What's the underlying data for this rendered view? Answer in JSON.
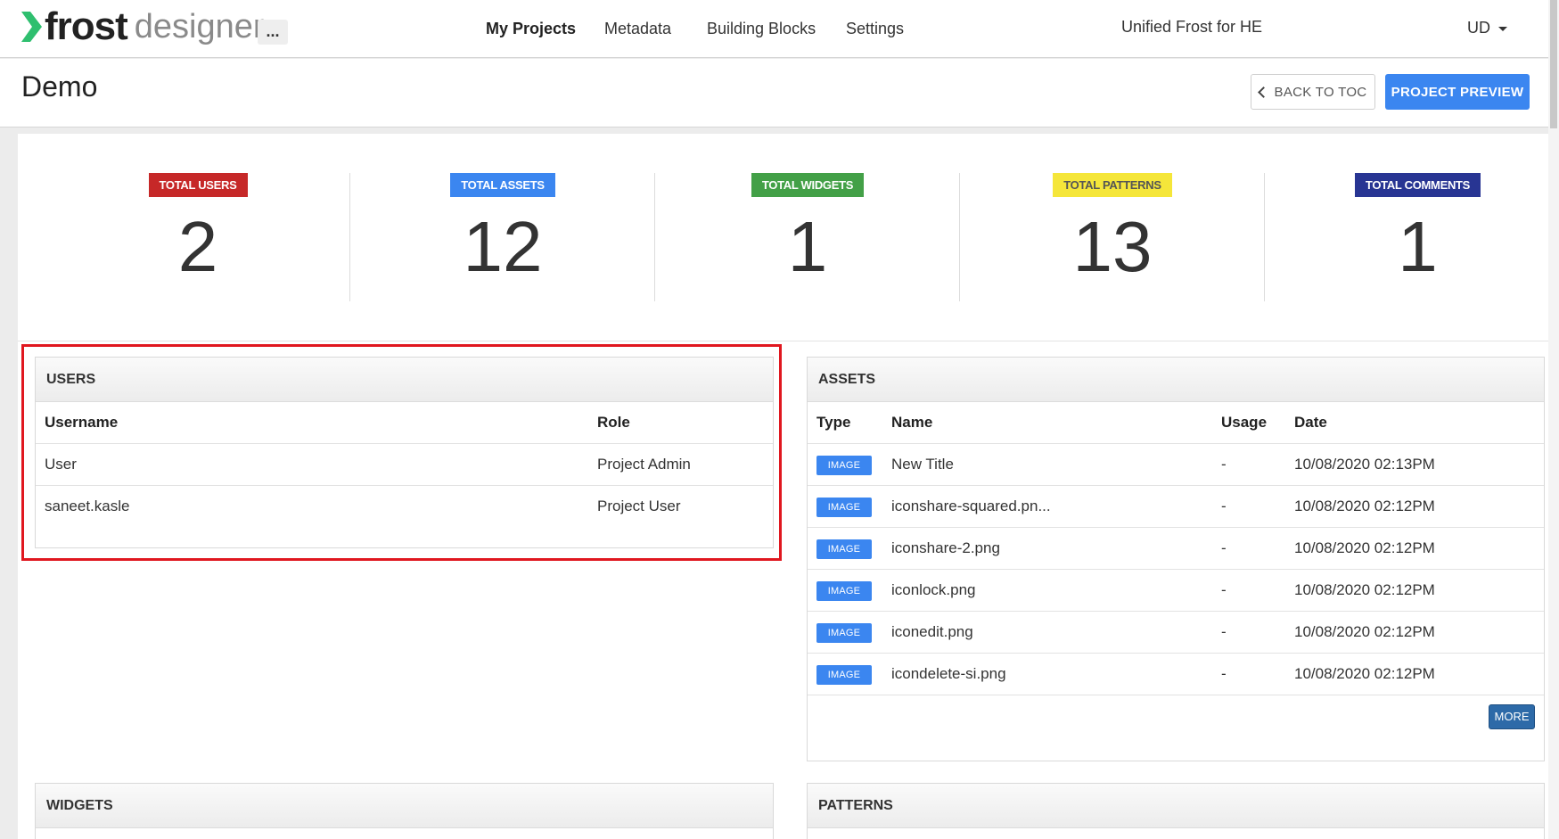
{
  "header": {
    "logo_frost": "frost",
    "logo_designer": "designer",
    "more_label": "...",
    "nav": [
      "My Projects",
      "Metadata",
      "Building Blocks",
      "Settings"
    ],
    "org_name": "Unified Frost for HE",
    "user_initials": "UD"
  },
  "titlebar": {
    "title": "Demo",
    "back_label": "BACK TO TOC",
    "preview_label": "PROJECT PREVIEW"
  },
  "stats": [
    {
      "label": "TOTAL USERS",
      "value": "2",
      "color": "#c62828"
    },
    {
      "label": "TOTAL ASSETS",
      "value": "12",
      "color": "#3b86f0"
    },
    {
      "label": "TOTAL WIDGETS",
      "value": "1",
      "color": "#43a047"
    },
    {
      "label": "TOTAL PATTERNS",
      "value": "13",
      "color": "#f5e63a"
    },
    {
      "label": "TOTAL COMMENTS",
      "value": "1",
      "color": "#283593"
    }
  ],
  "users": {
    "title": "USERS",
    "headers": [
      "Username",
      "Role"
    ],
    "rows": [
      [
        "User",
        "Project Admin"
      ],
      [
        "saneet.kasle",
        "Project User"
      ]
    ]
  },
  "assets": {
    "title": "ASSETS",
    "headers": [
      "Type",
      "Name",
      "Usage",
      "Date"
    ],
    "rows": [
      [
        "IMAGE",
        "New Title",
        "-",
        "10/08/2020 02:13PM"
      ],
      [
        "IMAGE",
        "iconshare-squared.pn...",
        "-",
        "10/08/2020 02:12PM"
      ],
      [
        "IMAGE",
        "iconshare-2.png",
        "-",
        "10/08/2020 02:12PM"
      ],
      [
        "IMAGE",
        "iconlock.png",
        "-",
        "10/08/2020 02:12PM"
      ],
      [
        "IMAGE",
        "iconedit.png",
        "-",
        "10/08/2020 02:12PM"
      ],
      [
        "IMAGE",
        "icondelete-si.png",
        "-",
        "10/08/2020 02:12PM"
      ]
    ],
    "more_label": "MORE"
  },
  "widgets": {
    "title": "WIDGETS"
  },
  "patterns": {
    "title": "PATTERNS"
  },
  "colors": {
    "accent": "#3b86f0",
    "highlight": "#e0171f",
    "logo": "#2fbf6f"
  }
}
